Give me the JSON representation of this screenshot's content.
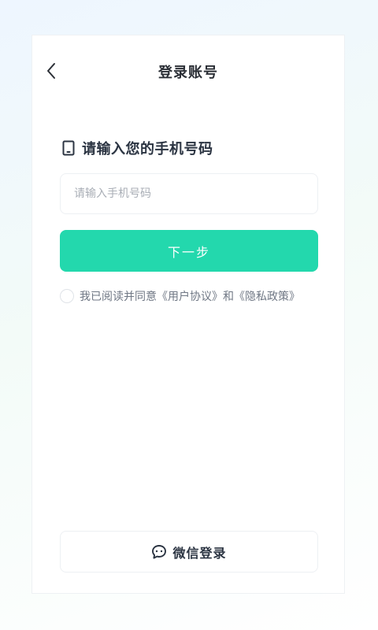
{
  "header": {
    "title": "登录账号"
  },
  "prompt": {
    "text": "请输入您的手机号码"
  },
  "phone_input": {
    "value": "",
    "placeholder": "请输入手机号码"
  },
  "next_button": {
    "label": "下一步"
  },
  "agreement": {
    "checked": false,
    "prefix": "我已阅读并同意",
    "user_agreement": "《用户协议》",
    "connector": "和",
    "privacy_policy": "《隐私政策》"
  },
  "wechat_login": {
    "label": "微信登录"
  },
  "icons": {
    "back": "chevron-left-icon",
    "phone": "phone-icon",
    "wechat": "chat-bubble-icon"
  },
  "colors": {
    "accent": "#23d8ad",
    "title_text": "#2b2f36",
    "body_text": "#6f7784",
    "placeholder": "#a9aeb6"
  }
}
